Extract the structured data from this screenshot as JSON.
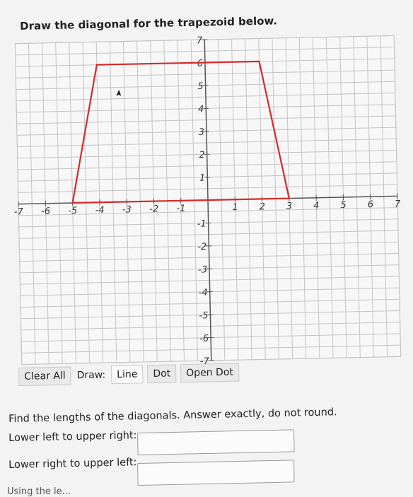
{
  "prompt": "Draw the diagonal for the trapezoid below.",
  "graph": {
    "x_range": [
      -7,
      7
    ],
    "y_range": [
      -7,
      7
    ],
    "x_tick_labels": [
      "-7",
      "-6",
      "-5",
      "-4",
      "-3",
      "-2",
      "-1",
      "1",
      "2",
      "3",
      "4",
      "5",
      "6",
      "7"
    ],
    "y_tick_labels": [
      "7",
      "6",
      "5",
      "4",
      "3",
      "2",
      "1",
      "-1",
      "-2",
      "-3",
      "-4",
      "-5",
      "-6",
      "-7"
    ],
    "grid_step": 0.5,
    "trapezoid_vertices": [
      [
        -5,
        0
      ],
      [
        -4,
        6
      ],
      [
        2,
        6
      ],
      [
        3,
        0
      ]
    ],
    "trapezoid_color": "#d42a2a",
    "grid_color": "#c4c4c4",
    "axis_color": "#555555"
  },
  "toolbar": {
    "clear_all": "Clear All",
    "draw_label": "Draw:",
    "line": "Line",
    "dot": "Dot",
    "open_dot": "Open Dot",
    "selected_tool": "Line"
  },
  "question": "Find the lengths of the diagonals. Answer exactly, do not round.",
  "answers": {
    "lower_left_label": "Lower left to upper right:",
    "lower_right_label": "Lower right to upper left:",
    "lower_left_value": "",
    "lower_right_value": ""
  },
  "cutoff_text": "Using the le..."
}
